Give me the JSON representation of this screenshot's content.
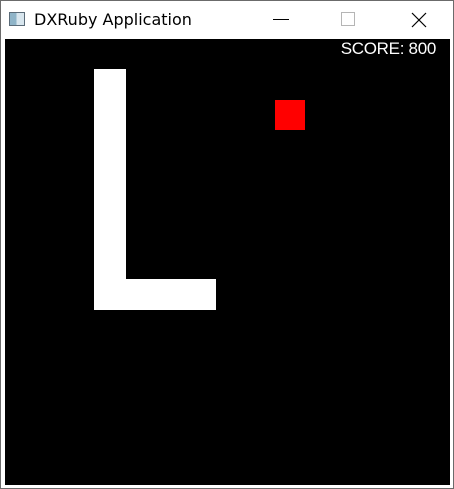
{
  "window": {
    "title": "DXRuby Application",
    "icon": "dxruby-window-icon",
    "controls": [
      "minimize-icon",
      "maximize-icon",
      "close-icon"
    ]
  },
  "game": {
    "background_color": "#000000",
    "score_text": "SCORE: 800",
    "falling_piece": {
      "shape": "L",
      "color": "#ffffff"
    },
    "food": {
      "color": "#ff0000"
    }
  }
}
